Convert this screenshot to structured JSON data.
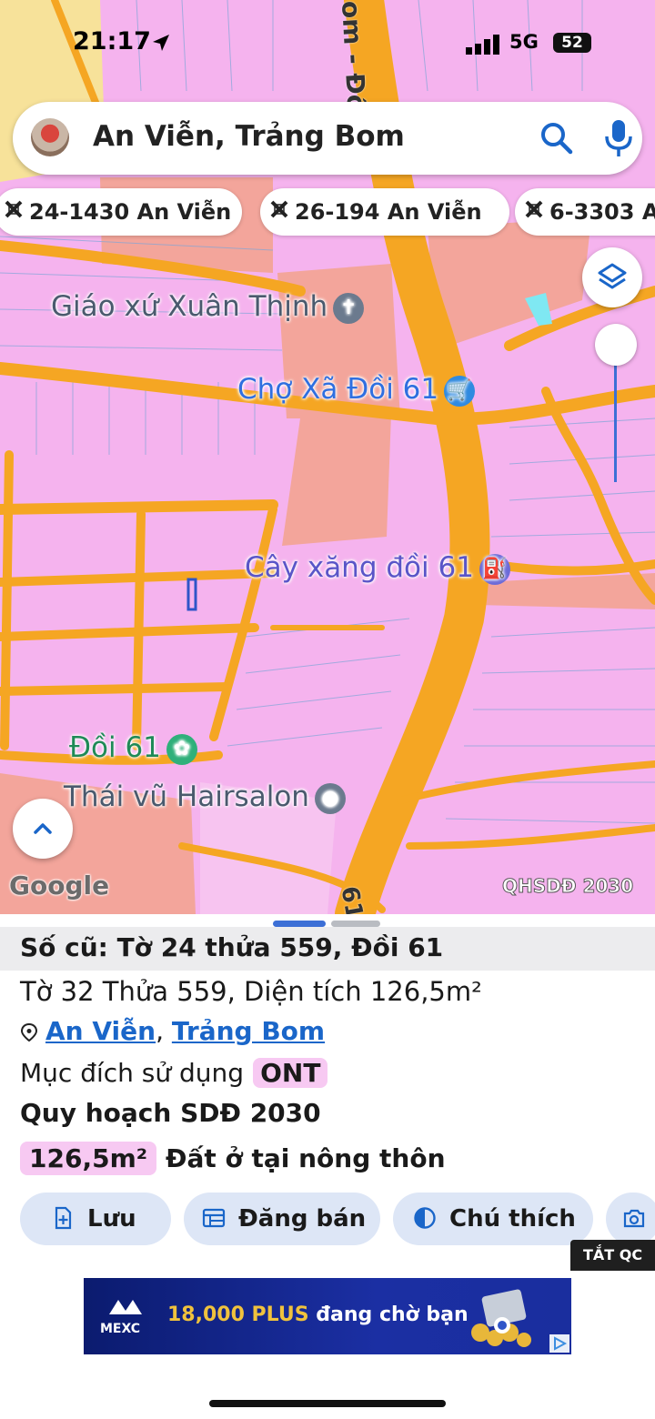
{
  "status_bar": {
    "time": "21:17",
    "network": "5G",
    "battery": "52"
  },
  "search": {
    "query": "An Viễn, Trảng Bom"
  },
  "chips": [
    {
      "label": "24-1430 An Viễn"
    },
    {
      "label": "26-194 An Viễn"
    },
    {
      "label": "6-3303 A"
    }
  ],
  "map": {
    "pois": [
      {
        "label": "Giáo xứ Xuân Thịnh",
        "icon": "church-icon",
        "color": "#4a5a6e"
      },
      {
        "label": "Chợ Xã Đồi 61",
        "icon": "shopping-cart-icon",
        "color": "#2f6fe0"
      },
      {
        "label": "Cây xăng đồi 61",
        "icon": "gas-station-icon",
        "color": "#5a55c8"
      },
      {
        "label": "Đồi 61",
        "icon": "flower-icon",
        "color": "#1f8a57"
      },
      {
        "label": "Thái vũ Hairsalon",
        "icon": "place-icon",
        "color": "#4a5a6e"
      }
    ],
    "road_label_top": "om - Đồ",
    "road_label_bottom": "61",
    "google_logo": "Google",
    "overlay_label": "QHSDĐ 2030"
  },
  "sheet": {
    "old_parcel": "Số cũ: Tờ 24 thửa 559, Đồi 61",
    "parcel_info": "Tờ 32 Thửa 559, Diện tích 126,5m²",
    "location_ward": "An Viễn",
    "location_sep": ", ",
    "location_district": "Trảng Bom",
    "purpose_label": "Mục đích sử dụng",
    "purpose_code": "ONT",
    "planning_title": "Quy hoạch SDĐ 2030",
    "planning_area": "126,5m²",
    "planning_type": "Đất ở tại nông thôn",
    "actions": [
      {
        "label": "Lưu",
        "icon": "add-file-icon"
      },
      {
        "label": "Đăng bán",
        "icon": "listing-icon"
      },
      {
        "label": "Chú thích",
        "icon": "contrast-icon"
      },
      {
        "label": "",
        "icon": "camera-add-icon"
      }
    ]
  },
  "ad": {
    "close_label": "TẮT QC",
    "brand": "MEXC",
    "text_highlight": "18,000 PLUS",
    "text_rest": " đang chờ bạn"
  },
  "colors": {
    "land": "#f5b3ee",
    "road": "#f5a623",
    "commercial": "#f3a59b",
    "accent": "#1a66c9"
  }
}
